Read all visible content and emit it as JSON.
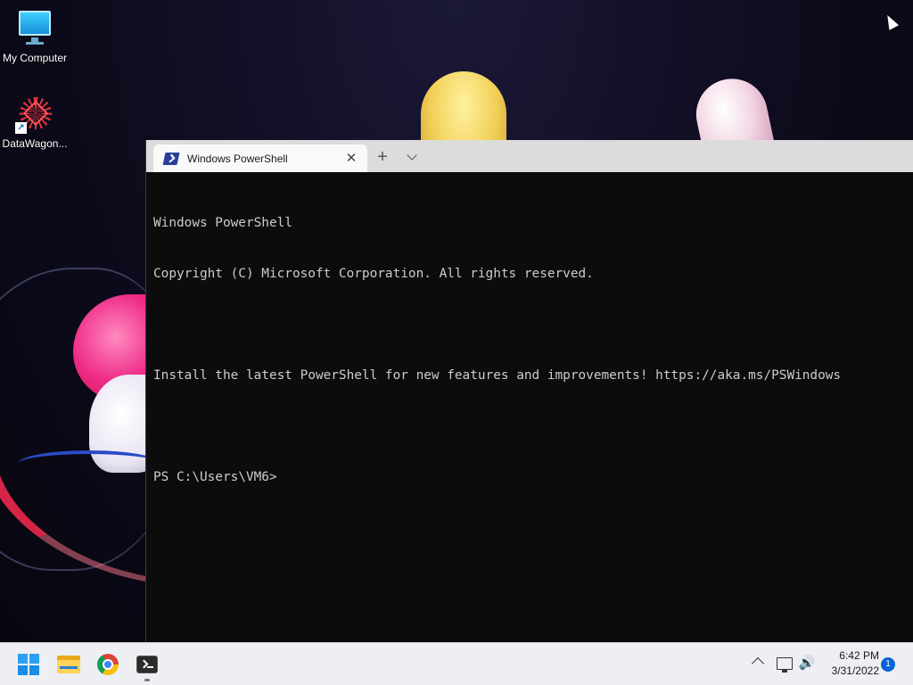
{
  "desktop": {
    "icons": [
      {
        "label": "My Computer",
        "icon": "monitor-icon"
      },
      {
        "label": "DataWagon...",
        "icon": "datawagon-icon"
      }
    ]
  },
  "terminal": {
    "tab": {
      "title": "Windows PowerShell",
      "icon": "powershell-icon",
      "close_icon": "close-icon"
    },
    "new_tab_glyph": "+",
    "console_lines": [
      "Windows PowerShell",
      "Copyright (C) Microsoft Corporation. All rights reserved.",
      "",
      "Install the latest PowerShell for new features and improvements! https://aka.ms/PSWindows",
      "",
      "PS C:\\Users\\VM6>"
    ],
    "colors": {
      "background": "#0c0c0c",
      "foreground": "#cccccc",
      "tabbar": "#dcdcdc"
    }
  },
  "taskbar": {
    "apps": [
      {
        "name": "Start",
        "icon": "windows-logo-icon"
      },
      {
        "name": "File Explorer",
        "icon": "folder-icon"
      },
      {
        "name": "Google Chrome",
        "icon": "chrome-icon"
      },
      {
        "name": "Terminal",
        "icon": "terminal-icon",
        "running": true
      }
    ],
    "tray": {
      "time": "6:42 PM",
      "date": "3/31/2022",
      "notification_count": "1"
    }
  }
}
